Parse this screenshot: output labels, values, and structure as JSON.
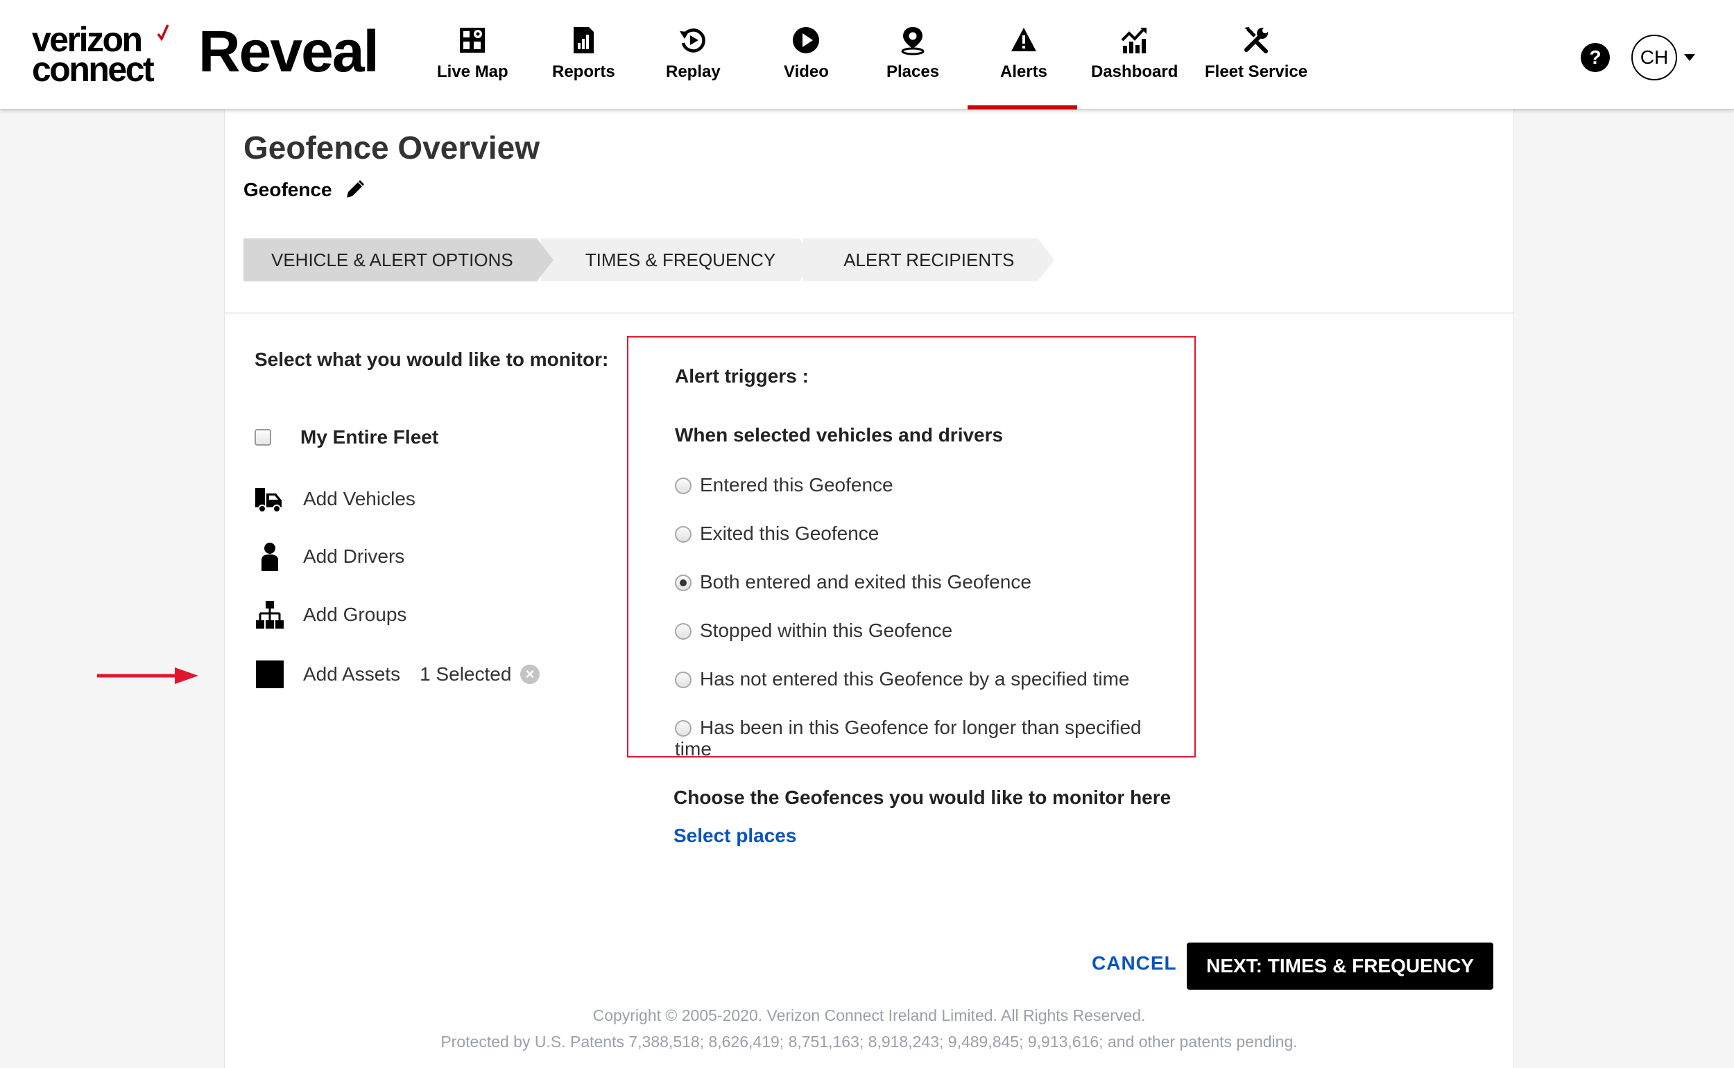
{
  "header": {
    "brand_top": "verizon",
    "brand_bottom": "connect",
    "app_name": "Reveal",
    "nav": [
      {
        "label": "Live Map",
        "icon": "live-map-icon"
      },
      {
        "label": "Reports",
        "icon": "reports-icon"
      },
      {
        "label": "Replay",
        "icon": "replay-icon"
      },
      {
        "label": "Video",
        "icon": "video-icon"
      },
      {
        "label": "Places",
        "icon": "places-icon"
      },
      {
        "label": "Alerts",
        "icon": "alerts-icon",
        "active": true
      },
      {
        "label": "Dashboard",
        "icon": "dashboard-icon"
      },
      {
        "label": "Fleet Service",
        "icon": "fleet-service-icon"
      }
    ],
    "help": "?",
    "user_initials": "CH",
    "accent_color": "#cd040b"
  },
  "page": {
    "title": "Geofence Overview",
    "subtitle": "Geofence",
    "steps": [
      "VEHICLE & ALERT OPTIONS",
      "TIMES & FREQUENCY",
      "ALERT RECIPIENTS"
    ],
    "active_step": "VEHICLE & ALERT OPTIONS"
  },
  "monitor": {
    "title": "Select what you would like to monitor:",
    "entire_fleet": "My Entire Fleet",
    "add_vehicles": "Add Vehicles",
    "add_drivers": "Add Drivers",
    "add_groups": "Add Groups",
    "add_assets": "Add Assets",
    "assets_selected": "1 Selected"
  },
  "triggers": {
    "title": "Alert triggers :",
    "subtitle": "When selected vehicles and drivers",
    "options": [
      "Entered this Geofence",
      "Exited this Geofence",
      "Both entered and exited this Geofence",
      "Stopped within this Geofence",
      "Has not entered this Geofence by a specified time",
      "Has been in this Geofence for longer than specified time"
    ],
    "selected": "Both entered and exited this Geofence"
  },
  "geofences": {
    "title": "Choose the Geofences you would like to monitor here",
    "link": "Select places"
  },
  "actions": {
    "cancel": "CANCEL",
    "next": "NEXT: TIMES & FREQUENCY"
  },
  "footer": {
    "copyright": "Copyright © 2005-2020. Verizon Connect Ireland Limited. All Rights Reserved.",
    "patents": "Protected by U.S. Patents 7,388,518; 8,626,419; 8,751,163; 8,918,243; 9,489,845; 9,913,616; and other patents pending."
  }
}
